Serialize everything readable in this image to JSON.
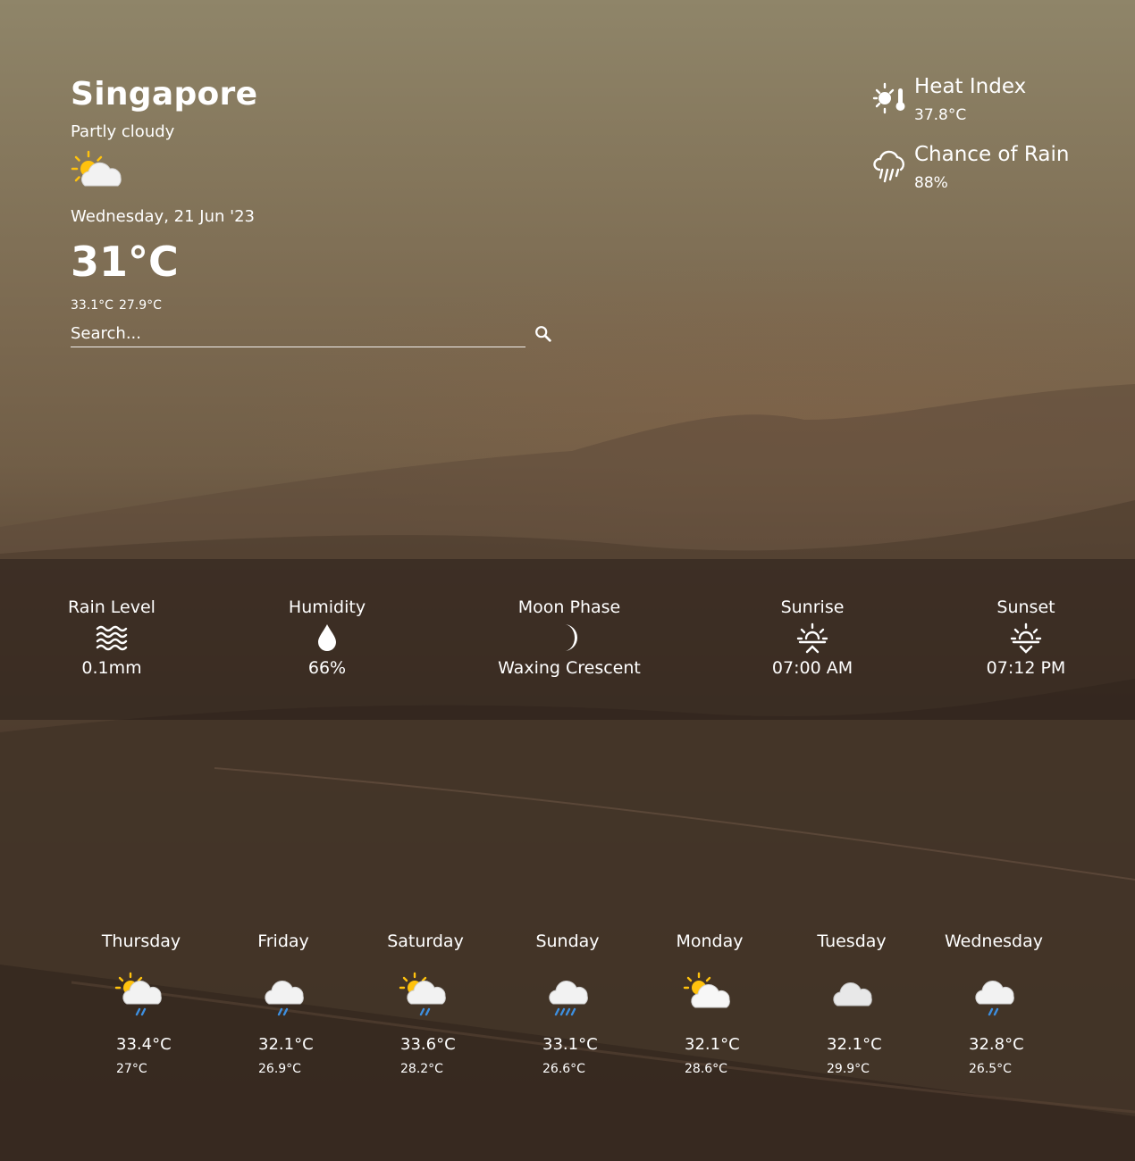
{
  "location": {
    "city": "Singapore",
    "condition": "Partly cloudy",
    "condition_icon": "partly-cloudy-icon",
    "date": "Wednesday, 21 Jun '23",
    "temperature": "31°C",
    "max_temp": "33.1°C",
    "min_temp": "27.9°C"
  },
  "search": {
    "placeholder": "Search..."
  },
  "side": {
    "heat_index": {
      "label": "Heat Index",
      "value": "37.8°C",
      "icon": "heat-index-icon"
    },
    "chance_of_rain": {
      "label": "Chance of Rain",
      "value": "88%",
      "icon": "rain-cloud-icon"
    }
  },
  "stats": [
    {
      "label": "Rain Level",
      "value": "0.1mm",
      "icon": "waves-icon"
    },
    {
      "label": "Humidity",
      "value": "66%",
      "icon": "droplet-icon"
    },
    {
      "label": "Moon Phase",
      "value": "Waxing Crescent",
      "icon": "crescent-moon-icon"
    },
    {
      "label": "Sunrise",
      "value": "07:00 AM",
      "icon": "sunrise-icon"
    },
    {
      "label": "Sunset",
      "value": "07:12 PM",
      "icon": "sunset-icon"
    }
  ],
  "forecast": [
    {
      "day": "Thursday",
      "max": "33.4°C",
      "min": "27°C",
      "icon": "sun-cloud-rain-icon"
    },
    {
      "day": "Friday",
      "max": "32.1°C",
      "min": "26.9°C",
      "icon": "cloud-rain-icon"
    },
    {
      "day": "Saturday",
      "max": "33.6°C",
      "min": "28.2°C",
      "icon": "sun-cloud-rain-icon"
    },
    {
      "day": "Sunday",
      "max": "33.1°C",
      "min": "26.6°C",
      "icon": "cloud-heavy-rain-icon"
    },
    {
      "day": "Monday",
      "max": "32.1°C",
      "min": "28.6°C",
      "icon": "sun-cloud-icon"
    },
    {
      "day": "Tuesday",
      "max": "32.1°C",
      "min": "29.9°C",
      "icon": "cloud-icon"
    },
    {
      "day": "Wednesday",
      "max": "32.8°C",
      "min": "26.5°C",
      "icon": "cloud-rain-icon"
    }
  ],
  "colors": {
    "sun": "#ffc20e",
    "cloud": "#f2f2f2",
    "rain": "#3d8fe0"
  }
}
